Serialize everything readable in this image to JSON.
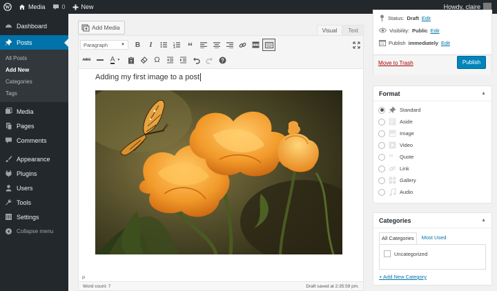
{
  "adminbar": {
    "site": "Media",
    "comments": "0",
    "new": "New",
    "howdy": "Howdy, claire"
  },
  "sidebar": {
    "dashboard": "Dashboard",
    "posts": "Posts",
    "sub": [
      "All Posts",
      "Add New",
      "Categories",
      "Tags"
    ],
    "items": [
      "Media",
      "Pages",
      "Comments",
      "Appearance",
      "Plugins",
      "Users",
      "Tools",
      "Settings",
      "Collapse menu"
    ]
  },
  "editor": {
    "add_media": "Add Media",
    "tab_visual": "Visual",
    "tab_text": "Text",
    "format_select": "Paragraph",
    "content_text": "Adding my first image to a post",
    "path": "P",
    "word_count": "Word count: 7",
    "draft_saved": "Draft saved at 2:35:59 pm."
  },
  "publish": {
    "status_label": "Status:",
    "status_value": "Draft",
    "visibility_label": "Visibility:",
    "visibility_value": "Public",
    "publish_label": "Publish",
    "publish_value": "immediately",
    "edit": "Edit",
    "trash": "Move to Trash",
    "button": "Publish"
  },
  "format": {
    "title": "Format",
    "options": [
      "Standard",
      "Aside",
      "Image",
      "Video",
      "Quote",
      "Link",
      "Gallery",
      "Audio"
    ],
    "selected": "Standard"
  },
  "categories": {
    "title": "Categories",
    "tab_all": "All Categories",
    "tab_used": "Most Used",
    "items": [
      "Uncategorized"
    ],
    "add_new": "+ Add New Category"
  },
  "colors": {
    "accent": "#0073aa",
    "adminbar": "#23282d",
    "publish": "#0085ba"
  }
}
